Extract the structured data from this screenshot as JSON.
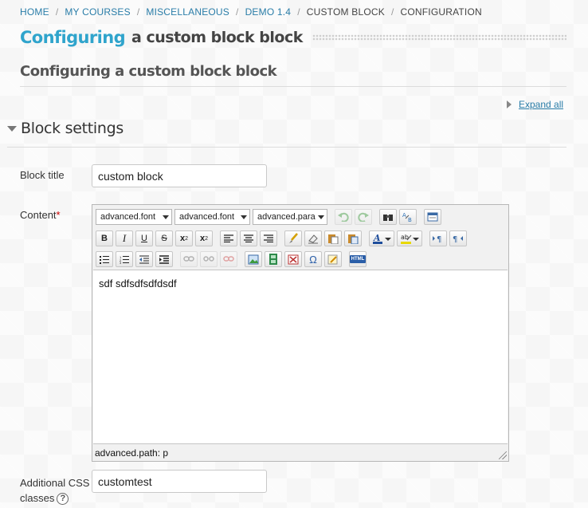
{
  "breadcrumb": {
    "items": [
      "HOME",
      "MY COURSES",
      "MISCELLANEOUS",
      "DEMO 1.4"
    ],
    "custom_block": "CUSTOM BLOCK",
    "current": "CONFIGURATION",
    "separator": "/"
  },
  "heading": {
    "accent": "Configuring",
    "rest": "a custom block block",
    "sub": "Configuring a custom block block"
  },
  "expand_all": "Expand all",
  "section": {
    "title": "Block settings"
  },
  "form": {
    "block_title_label": "Block title",
    "block_title_value": "custom block",
    "content_label": "Content",
    "required_mark": "*",
    "css_label_line1": "Additional CSS",
    "css_label_line2": "classes",
    "css_value": "customtest",
    "help_glyph": "?"
  },
  "editor": {
    "font_family_select": "advanced.font",
    "font_size_select": "advanced.font",
    "paragraph_select": "advanced.para",
    "content": "sdf sdfsdfsdfdsdf",
    "path": "advanced.path: p",
    "buttons": {
      "bold": "B",
      "italic": "I",
      "underline": "U",
      "strike": "S",
      "subscript": "x",
      "superscript": "x",
      "omega": "Ω",
      "html": "HTML"
    }
  },
  "colors": {
    "link": "#2a7da8",
    "accent_heading": "#2fa4cc",
    "required": "#cc0000"
  }
}
